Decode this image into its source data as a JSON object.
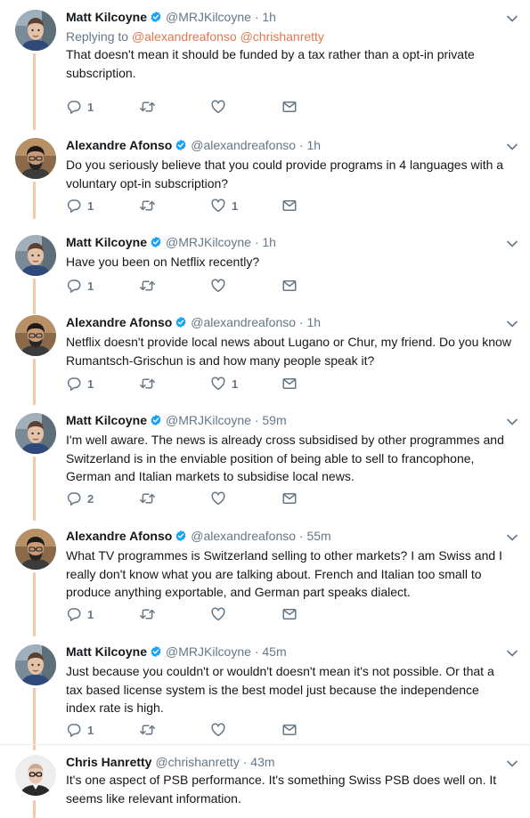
{
  "colors": {
    "thread_line": "#f6c7a8",
    "mention": "#e0784f",
    "verified": "#1da1f2",
    "muted": "#657786"
  },
  "icons": [
    "reply-icon",
    "retweet-icon",
    "like-icon",
    "direct-message-icon",
    "verified-icon",
    "chevron-down-icon"
  ],
  "tweets": [
    {
      "name": "Matt Kilcoyne",
      "handle": "@MRJKilcoyne",
      "dot": "·",
      "time": "1h",
      "replying_prefix": "Replying to",
      "replying_to": [
        "@alexandreafonso",
        "@chrishanretty"
      ],
      "text": "That doesn't mean it should be funded by a tax rather than a opt-in private subscription.",
      "reply_count": "1",
      "retweet_count": "",
      "like_count": ""
    },
    {
      "name": "Alexandre Afonso",
      "handle": "@alexandreafonso",
      "dot": "·",
      "time": "1h",
      "text": "Do you seriously believe that you could provide programs in 4 languages with a voluntary opt-in subscription?",
      "reply_count": "1",
      "retweet_count": "",
      "like_count": "1"
    },
    {
      "name": "Matt Kilcoyne",
      "handle": "@MRJKilcoyne",
      "dot": "·",
      "time": "1h",
      "text": "Have you been on Netflix recently?",
      "reply_count": "1",
      "retweet_count": "",
      "like_count": ""
    },
    {
      "name": "Alexandre Afonso",
      "handle": "@alexandreafonso",
      "dot": "·",
      "time": "1h",
      "text": "Netflix doesn't provide local news about Lugano or Chur, my friend. Do you know Rumantsch-Grischun is and how many people speak it?",
      "reply_count": "1",
      "retweet_count": "",
      "like_count": "1"
    },
    {
      "name": "Matt Kilcoyne",
      "handle": "@MRJKilcoyne",
      "dot": "·",
      "time": "59m",
      "text": "I'm well aware. The news is already cross subsidised by other programmes and Switzerland is in the enviable position of being able to sell to francophone, German and Italian markets to subsidise local news.",
      "reply_count": "2",
      "retweet_count": "",
      "like_count": ""
    },
    {
      "name": "Alexandre Afonso",
      "handle": "@alexandreafonso",
      "dot": "·",
      "time": "55m",
      "text": "What TV programmes is Switzerland selling to other markets? I am Swiss and I really don't know what you are talking about. French and Italian too small to produce anything exportable, and German part speaks dialect.",
      "reply_count": "1",
      "retweet_count": "",
      "like_count": ""
    },
    {
      "name": "Matt Kilcoyne",
      "handle": "@MRJKilcoyne",
      "dot": "·",
      "time": "45m",
      "text": "Just because you couldn't or wouldn't doesn't mean it's not possible. Or that a tax based license system is the best model just because the independence index rate is high.",
      "reply_count": "1",
      "retweet_count": "",
      "like_count": ""
    },
    {
      "name": "Chris Hanretty",
      "handle": "@chrishanretty",
      "dot": "·",
      "time": "43m",
      "text": "It's one aspect of PSB performance. It's something Swiss PSB does well on. It seems like relevant information.",
      "reply_count": "",
      "retweet_count": "",
      "like_count": ""
    }
  ]
}
